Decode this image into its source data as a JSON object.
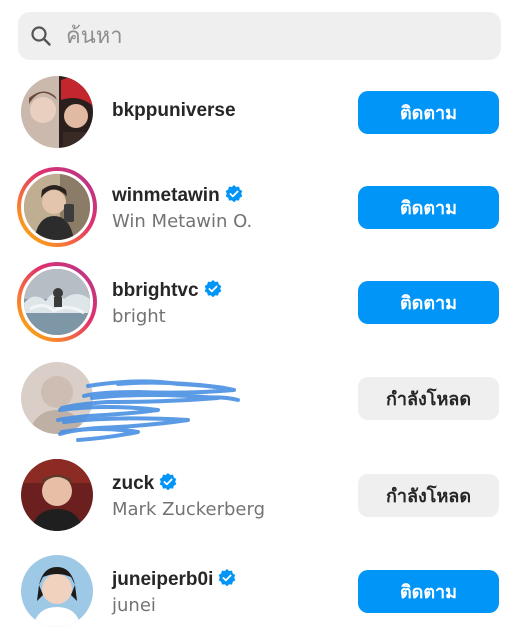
{
  "search": {
    "placeholder": "ค้นหา",
    "icon": "search-icon"
  },
  "accounts": [
    {
      "username": "bkppuniverse",
      "full_name": "",
      "verified": false,
      "story_ring": false,
      "button_label": "ติดตาม",
      "button_state": "follow"
    },
    {
      "username": "winmetawin",
      "full_name": "Win Metawin O.",
      "verified": true,
      "story_ring": true,
      "button_label": "ติดตาม",
      "button_state": "follow"
    },
    {
      "username": "bbrightvc",
      "full_name": "bright",
      "verified": true,
      "story_ring": true,
      "button_label": "ติดตาม",
      "button_state": "follow"
    },
    {
      "username": "",
      "full_name": "",
      "verified": false,
      "story_ring": false,
      "redacted": true,
      "button_label": "กำลังโหลด",
      "button_state": "loading"
    },
    {
      "username": "zuck",
      "full_name": "Mark Zuckerberg",
      "verified": true,
      "story_ring": false,
      "button_label": "กำลังโหลด",
      "button_state": "loading"
    },
    {
      "username": "juneiperb0i",
      "full_name": "junei",
      "verified": true,
      "story_ring": false,
      "button_label": "ติดตาม",
      "button_state": "follow"
    }
  ],
  "colors": {
    "follow_button": "#0095f6",
    "loading_button": "#efefef",
    "verified_badge": "#0095f6",
    "redaction_scribble": "#4a90e2"
  }
}
